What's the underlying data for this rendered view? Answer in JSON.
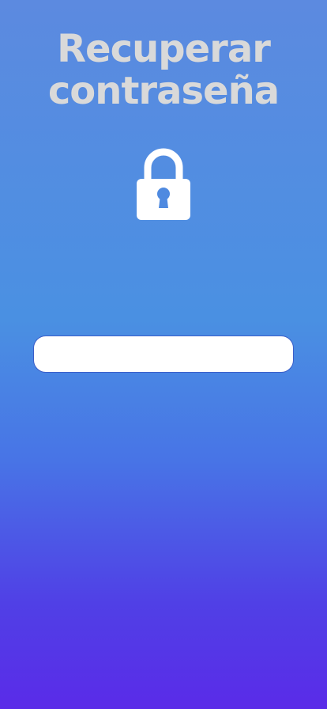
{
  "header": {
    "title_line1": "Recuperar",
    "title_line2": "contraseña"
  },
  "icons": {
    "lock": "lock-icon"
  },
  "form": {
    "email_value": "",
    "email_placeholder": ""
  },
  "colors": {
    "gradient_top": "#5c8ae0",
    "gradient_bottom": "#5a2be8",
    "title": "#d9d9d9",
    "input_border": "#3a5ec9"
  }
}
